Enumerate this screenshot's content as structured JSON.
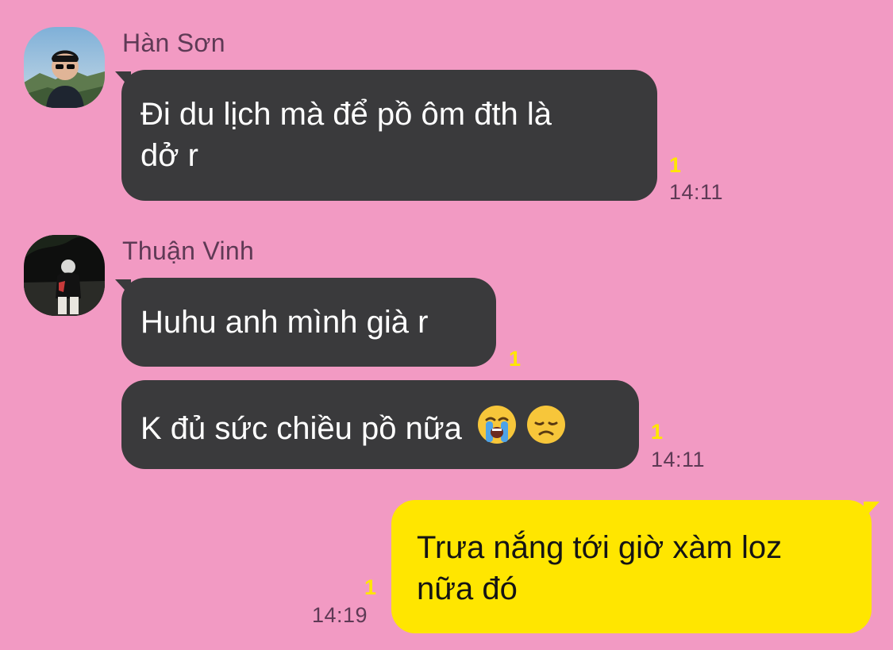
{
  "messages": [
    {
      "sender": "Hàn Sơn",
      "lines": [
        "Đi du lịch mà để pồ ôm đth là",
        "dở r"
      ],
      "unread": "1",
      "time": "14:11"
    },
    {
      "sender": "Thuận Vinh",
      "text": "Huhu anh mình già r",
      "unread": "1"
    },
    {
      "text": "K đủ sức chiều pồ nữa",
      "emojis": [
        "crying-face-emoji",
        "disappointed-face-emoji"
      ],
      "unread": "1",
      "time": "14:11"
    },
    {
      "lines": [
        "Trưa nắng tới giờ xàm loz",
        "nữa đó"
      ],
      "unread": "1",
      "time": "14:19",
      "outgoing": true
    }
  ],
  "colors": {
    "background": "#f29ac3",
    "incoming_bubble": "#3a3a3c",
    "outgoing_bubble": "#ffe600",
    "unread_badge": "#ffe600",
    "meta_text": "#5e3a55"
  }
}
